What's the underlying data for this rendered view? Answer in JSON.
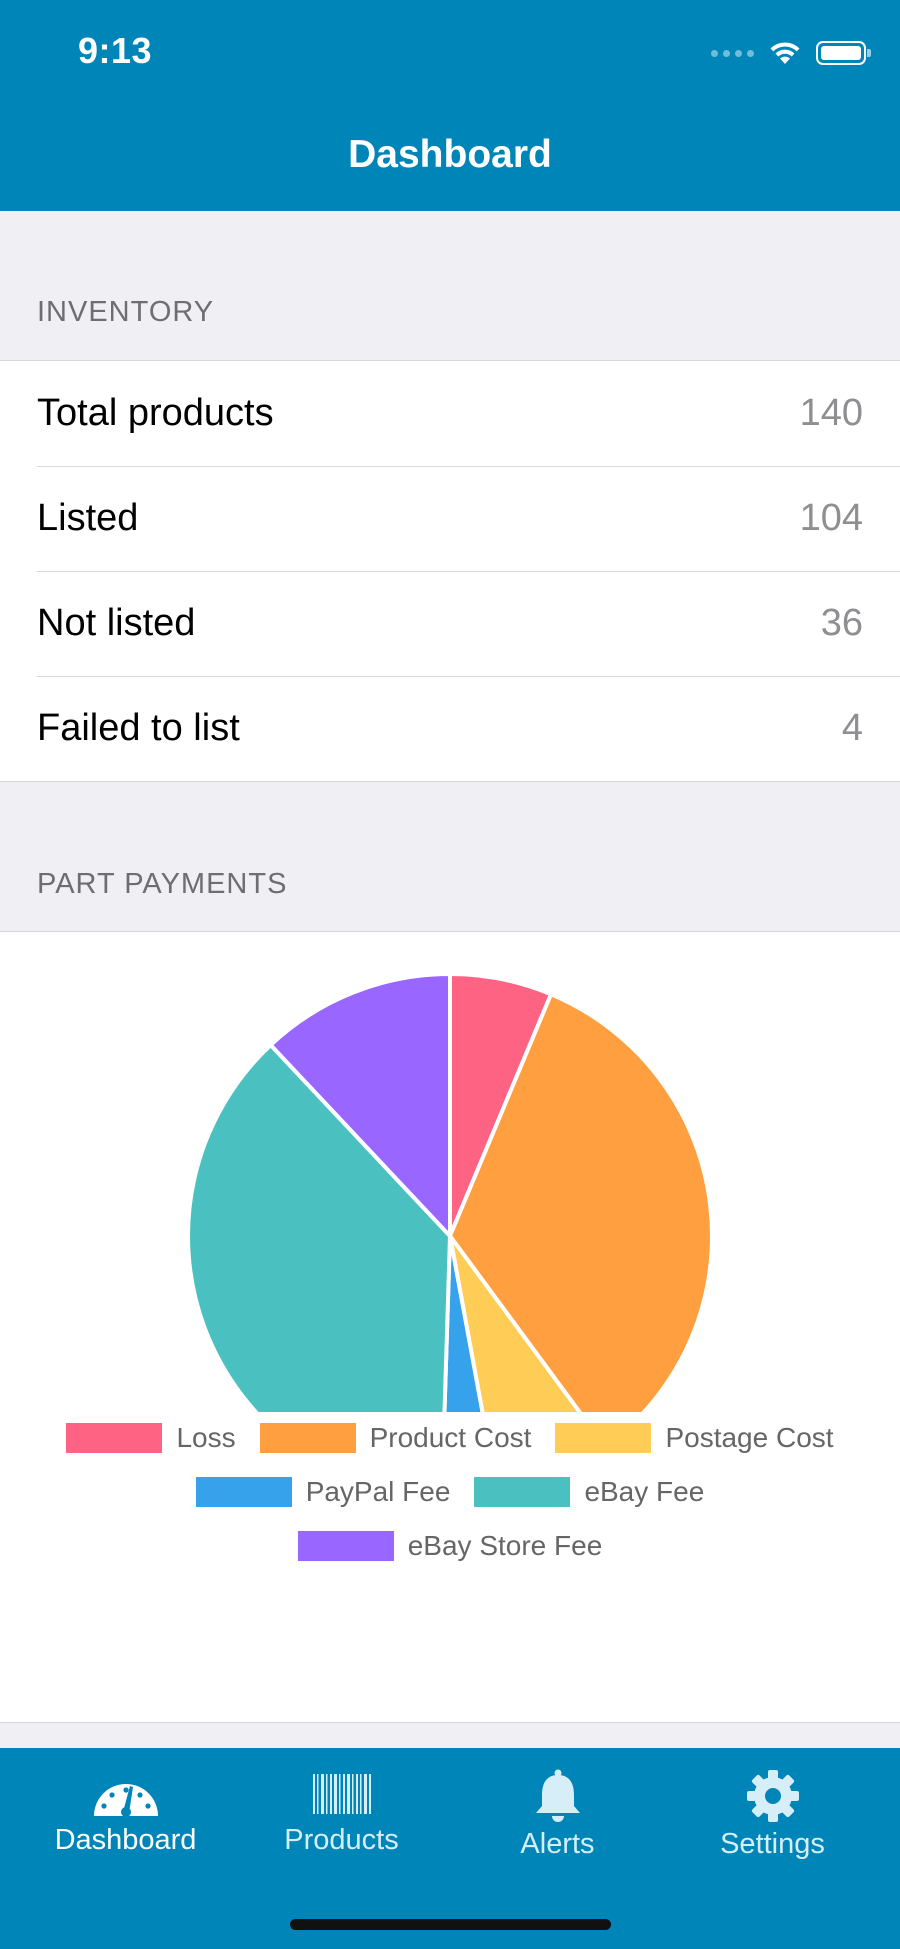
{
  "status_bar": {
    "time": "9:13"
  },
  "nav": {
    "title": "Dashboard"
  },
  "inventory": {
    "header": "INVENTORY",
    "rows": [
      {
        "label": "Total products",
        "value": "140"
      },
      {
        "label": "Listed",
        "value": "104"
      },
      {
        "label": "Not listed",
        "value": "36"
      },
      {
        "label": "Failed to list",
        "value": "4"
      }
    ]
  },
  "part_payments": {
    "header": "PART PAYMENTS"
  },
  "chart_data": {
    "type": "pie",
    "title": "",
    "categories": [
      "Loss",
      "Product Cost",
      "Postage Cost",
      "PayPal Fee",
      "eBay Fee",
      "eBay Store Fee"
    ],
    "values": [
      6.3,
      33.6,
      7.2,
      3.4,
      37.5,
      12.0
    ],
    "colors": [
      "#ff6384",
      "#ff9f40",
      "#ffcd56",
      "#36a2eb",
      "#4bc0c0",
      "#9966ff"
    ],
    "legend": "bottom"
  },
  "tabs": [
    {
      "label": "Dashboard",
      "icon": "dashboard-gauge-icon"
    },
    {
      "label": "Products",
      "icon": "barcode-icon"
    },
    {
      "label": "Alerts",
      "icon": "bell-icon"
    },
    {
      "label": "Settings",
      "icon": "gear-icon"
    }
  ],
  "colors": {
    "brand": "#0085b8",
    "tab_active": "#ffffff",
    "tab_inactive": "#d6eef8"
  }
}
